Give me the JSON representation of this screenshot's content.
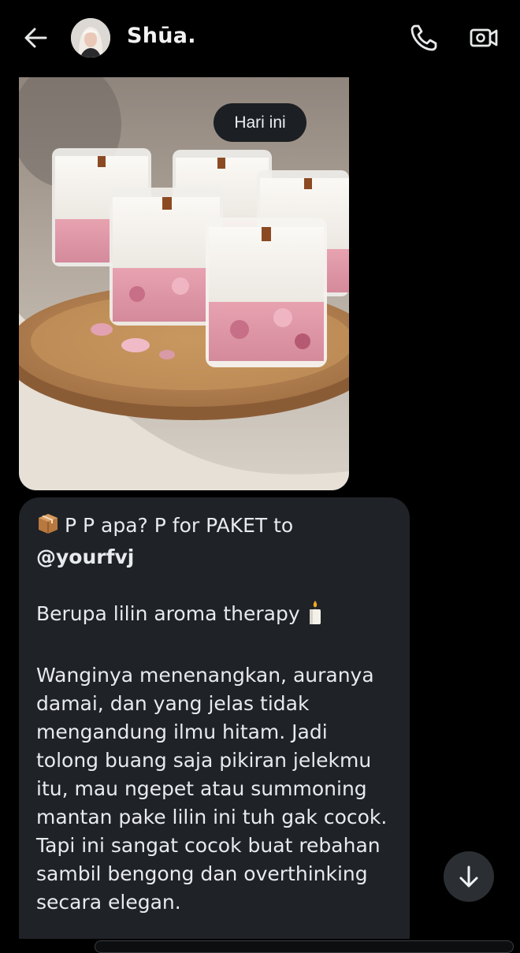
{
  "header": {
    "contact_name": "Shūa.",
    "icons": {
      "back": "arrow-left-icon",
      "call": "phone-icon",
      "video": "video-camera-icon"
    }
  },
  "media": {
    "date_label": "Hari ini"
  },
  "message": {
    "line1": "P P apa? P for PAKET to",
    "line2": "@yourfvj",
    "line3": "Berupa lilin aroma therapy",
    "body_lines": [
      "Wanginya menenangkan, auranya",
      "damai, dan yang jelas tidak",
      "mengandung ilmu hitam. Jadi",
      "tolong buang saja pikiran jelekmu",
      "itu, mau ngepet atau summoning",
      "mantan pake lilin ini tuh gak cocok.",
      "Tapi ini sangat cocok buat rebahan",
      "sambil bengong dan overthinking",
      "secara elegan."
    ]
  },
  "scroll_button": {
    "icon": "arrow-down-icon"
  },
  "colors": {
    "background": "#000000",
    "bubble": "#1f2226",
    "text": "#e8eaed"
  }
}
